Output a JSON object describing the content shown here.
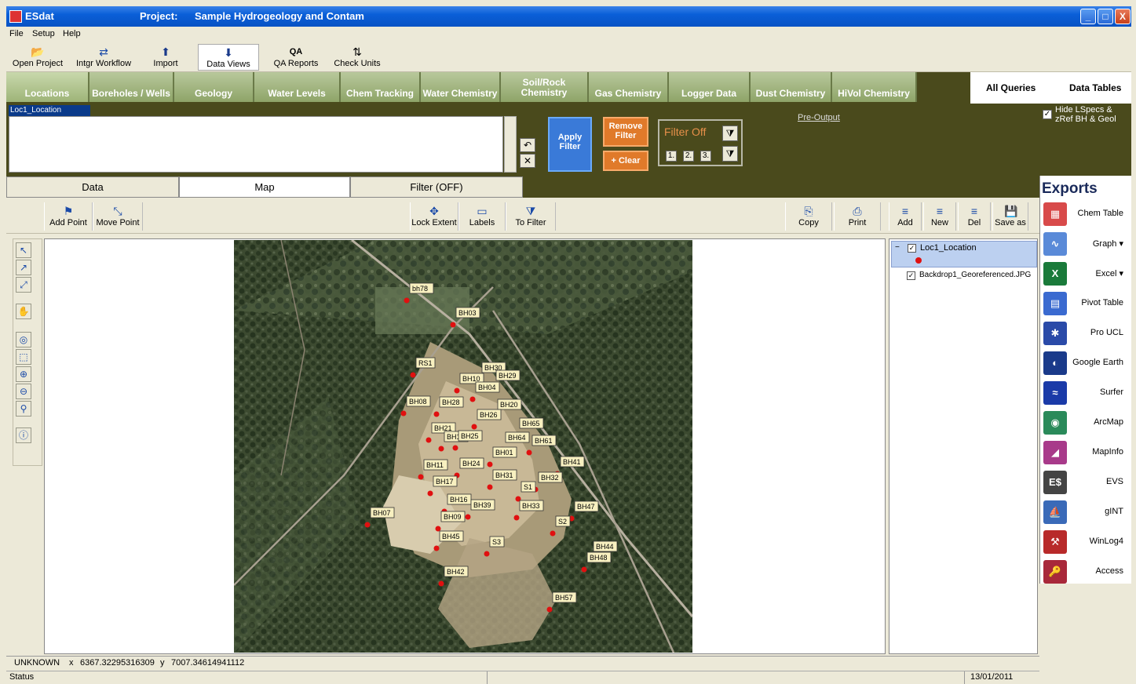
{
  "window": {
    "app_title": "ESdat",
    "project_label": "Project:",
    "project_name": "Sample Hydrogeology and Contam",
    "controls": {
      "minimize": "_",
      "maximize": "□",
      "close": "X"
    }
  },
  "menu": {
    "items": [
      "File",
      "Setup",
      "Help"
    ]
  },
  "toolbar": {
    "items": [
      {
        "label": "Open Project",
        "icon": "folder-open-icon",
        "glyph": "📂"
      },
      {
        "label": "Intgr Workflow",
        "icon": "workflow-icon",
        "glyph": "⇄"
      },
      {
        "label": "Import",
        "icon": "arrow-up-icon",
        "glyph": "⬆"
      },
      {
        "label": "Data Views",
        "icon": "arrow-down-icon",
        "glyph": "⬇"
      },
      {
        "label": "QA Reports",
        "icon": "qa-icon",
        "glyph": "QA"
      },
      {
        "label": "Check Units",
        "icon": "units-icon",
        "glyph": "⇅"
      }
    ]
  },
  "tabs": [
    "Locations",
    "Boreholes / Wells",
    "Geology",
    "Water Levels",
    "Chem Tracking",
    "Water Chemistry",
    "Soil/Rock Chemistry",
    "Gas Chemistry",
    "Logger Data",
    "Dust Chemistry",
    "HiVol Chemistry"
  ],
  "right_tabs": [
    "All Queries",
    "Data Tables"
  ],
  "hide_option": {
    "checked": "✓",
    "label": "Hide LSpecs & zRef BH & Geol"
  },
  "filter": {
    "location_label": "Loc1_Location",
    "apply": "Apply Filter",
    "remove": "Remove Filter",
    "clear": "+ Clear",
    "state": "Filter Off",
    "numbers": [
      "1.",
      "2.",
      "3."
    ],
    "pre_output": "Pre-Output"
  },
  "view_tabs": [
    "Data",
    "Map",
    "Filter (OFF)"
  ],
  "map_toolbar": {
    "add_point": "Add Point",
    "move_point": "Move Point",
    "lock_extent": "Lock Extent",
    "labels": "Labels",
    "to_filter": "To Filter",
    "copy": "Copy",
    "print": "Print",
    "add": "Add",
    "new": "New",
    "del": "Del",
    "save_as": "Save as"
  },
  "layers": {
    "items": [
      {
        "name": "Loc1_Location",
        "checked": "✓"
      },
      {
        "name": "Backdrop1_Georeferenced.JPG",
        "checked": "✓"
      }
    ]
  },
  "exports": {
    "title": "Exports",
    "items": [
      {
        "label": "Chem Table",
        "icon": "chem-table-icon",
        "color": "#d84a4a",
        "glyph": "▦"
      },
      {
        "label": "Graph",
        "icon": "graph-icon",
        "color": "#5a8ad8",
        "glyph": "∿",
        "dropdown": "▾"
      },
      {
        "label": "Excel",
        "icon": "excel-icon",
        "color": "#1a7a3a",
        "glyph": "X",
        "dropdown": "▾"
      },
      {
        "label": "Pivot Table",
        "icon": "pivot-table-icon",
        "color": "#3a6ad0",
        "glyph": "▤"
      },
      {
        "label": "Pro UCL",
        "icon": "pro-ucl-icon",
        "color": "#2a4aa8",
        "glyph": "✱"
      },
      {
        "label": "Google Earth",
        "icon": "google-earth-icon",
        "color": "#1a3a8a",
        "glyph": "◐"
      },
      {
        "label": "Surfer",
        "icon": "surfer-icon",
        "color": "#1a3aa8",
        "glyph": "≈"
      },
      {
        "label": "ArcMap",
        "icon": "arcmap-icon",
        "color": "#2a8a5a",
        "glyph": "◉"
      },
      {
        "label": "MapInfo",
        "icon": "mapinfo-icon",
        "color": "#a83a8a",
        "glyph": "◢"
      },
      {
        "label": "EVS",
        "icon": "evs-icon",
        "color": "#444444",
        "glyph": "E$"
      },
      {
        "label": "gINT",
        "icon": "gint-icon",
        "color": "#3a6ab8",
        "glyph": "⛵"
      },
      {
        "label": "WinLog4",
        "icon": "winlog-icon",
        "color": "#b82a2a",
        "glyph": "⚒"
      },
      {
        "label": "Access",
        "icon": "access-icon",
        "color": "#a8283a",
        "glyph": "🔑"
      }
    ]
  },
  "map_points": [
    {
      "label": "bh78"
    },
    {
      "label": "BH03"
    },
    {
      "label": "RS1"
    },
    {
      "label": "BH30"
    },
    {
      "label": "BH29"
    },
    {
      "label": "BH10"
    },
    {
      "label": "BH04"
    },
    {
      "label": "BH08"
    },
    {
      "label": "BH28"
    },
    {
      "label": "BH20"
    },
    {
      "label": "BH26"
    },
    {
      "label": "BH65"
    },
    {
      "label": "BH21"
    },
    {
      "label": "BH18"
    },
    {
      "label": "BH25"
    },
    {
      "label": "BH64"
    },
    {
      "label": "BH61"
    },
    {
      "label": "BH01"
    },
    {
      "label": "BH41"
    },
    {
      "label": "BH11"
    },
    {
      "label": "BH24"
    },
    {
      "label": "BH17"
    },
    {
      "label": "BH31"
    },
    {
      "label": "BH32"
    },
    {
      "label": "S1"
    },
    {
      "label": "BH16"
    },
    {
      "label": "BH39"
    },
    {
      "label": "BH33"
    },
    {
      "label": "BH47"
    },
    {
      "label": "BH07"
    },
    {
      "label": "BH09"
    },
    {
      "label": "S2"
    },
    {
      "label": "BH45"
    },
    {
      "label": "S3"
    },
    {
      "label": "BH44"
    },
    {
      "label": "BH48"
    },
    {
      "label": "BH42"
    },
    {
      "label": "BH57"
    }
  ],
  "coordinates": {
    "system": "UNKNOWN",
    "x_label": "x",
    "x_value": "6367.32295316309",
    "y_label": "y",
    "y_value": "7007.34614941112"
  },
  "status": {
    "label": "Status",
    "date": "13/01/2011"
  }
}
